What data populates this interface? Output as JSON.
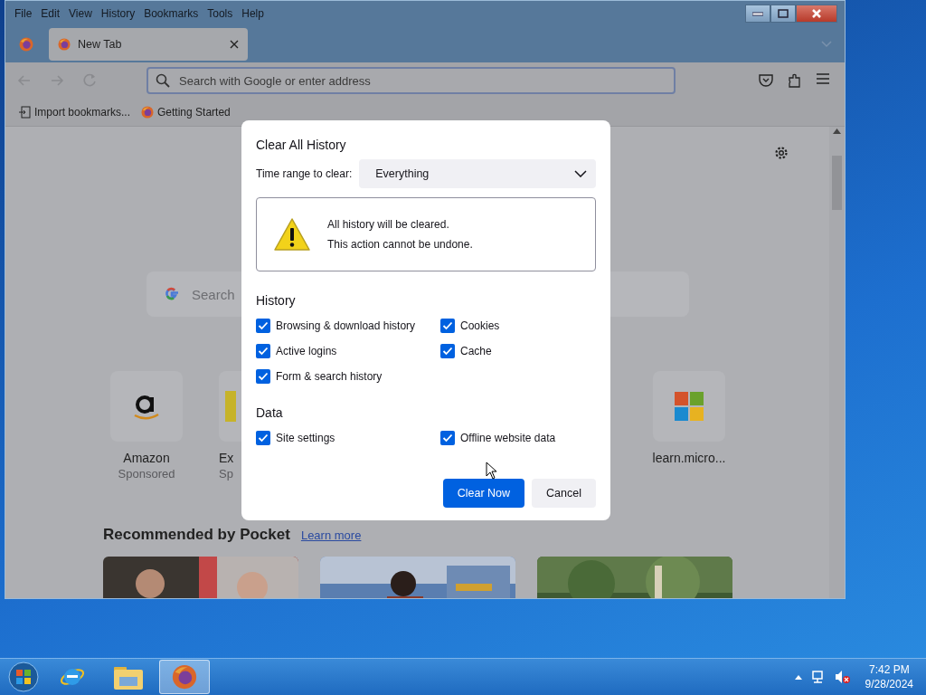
{
  "window": {
    "menu": [
      "File",
      "Edit",
      "View",
      "History",
      "Bookmarks",
      "Tools",
      "Help"
    ],
    "tabs": [
      {
        "label": "New Tab",
        "selected": true
      }
    ],
    "address": {
      "placeholder": "Search with Google or enter address"
    },
    "bookmarks": [
      {
        "label": "Import bookmarks...",
        "kind": "import"
      },
      {
        "label": "Getting Started",
        "kind": "firefox"
      }
    ]
  },
  "page": {
    "search": {
      "placeholder": "Search"
    },
    "tiles": [
      {
        "title": "Amazon",
        "subtitle": "Sponsored",
        "kind": "amazon"
      },
      {
        "title": "Ex",
        "subtitle": "Sp",
        "kind": "partial"
      },
      {
        "title": "learn.micro...",
        "kind": "windows"
      }
    ],
    "pocket": {
      "heading": "Recommended by Pocket",
      "link": "Learn more"
    }
  },
  "dialog": {
    "title": "Clear All History",
    "time_range": {
      "label": "Time range to clear:",
      "value": "Everything"
    },
    "warning": [
      "All history will be cleared.",
      "This action cannot be undone."
    ],
    "sections": [
      {
        "heading": "History",
        "options": [
          {
            "label": "Browsing & download history",
            "checked": true
          },
          {
            "label": "Cookies",
            "checked": true
          },
          {
            "label": "Active logins",
            "checked": true
          },
          {
            "label": "Cache",
            "checked": true
          },
          {
            "label": "Form & search history",
            "checked": true
          }
        ]
      },
      {
        "heading": "Data",
        "options": [
          {
            "label": "Site settings",
            "checked": true
          },
          {
            "label": "Offline website data",
            "checked": true
          }
        ]
      }
    ],
    "buttons": [
      {
        "label": "Clear Now",
        "kind": "primary"
      },
      {
        "label": "Cancel",
        "kind": "secondary"
      }
    ]
  },
  "taskbar": {
    "apps": [
      {
        "kind": "ie",
        "selected": false
      },
      {
        "kind": "folder",
        "selected": false
      },
      {
        "kind": "firefox",
        "selected": true
      }
    ],
    "time": "7:42 PM",
    "date": "9/28/2024"
  }
}
